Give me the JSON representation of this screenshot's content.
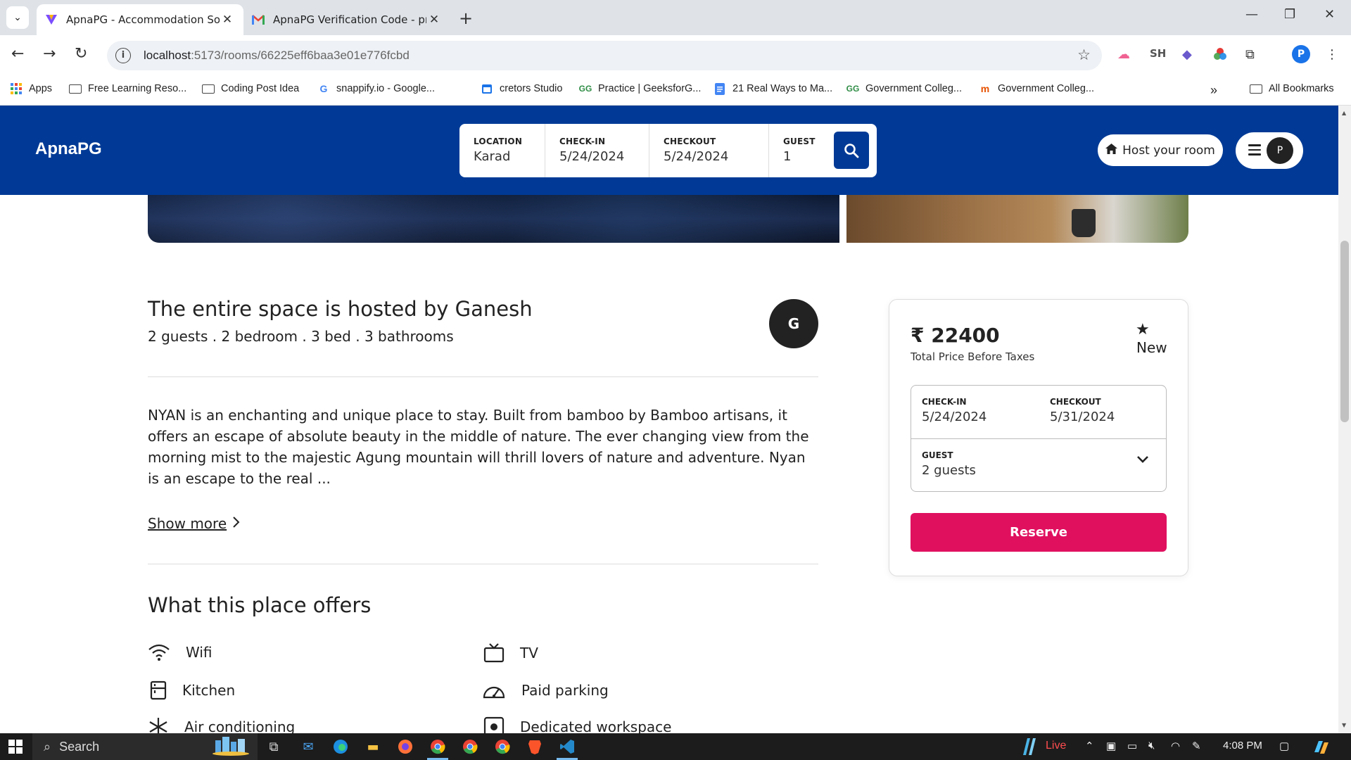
{
  "browser": {
    "tabs": [
      {
        "title": "ApnaPG - Accommodation Solu",
        "active": true
      },
      {
        "title": "ApnaPG Verification Code - pra",
        "active": false
      }
    ],
    "url_host": "localhost",
    "url_path": ":5173/rooms/66225eff6baa3e01e776fcbd",
    "profile_initial": "P",
    "ext_sh": "SH",
    "bookmarks": [
      "Apps",
      "Free Learning Reso...",
      "Coding Post Idea",
      "snappify.io - Google...",
      "cretors Studio",
      "Practice | GeeksforG...",
      "21 Real Ways to Ma...",
      "Government Colleg...",
      "Government Colleg...",
      "All Bookmarks"
    ]
  },
  "site": {
    "logo": "ApnaPG",
    "search": {
      "location_label": "LOCATION",
      "location_value": "Karad",
      "checkin_label": "CHECK-IN",
      "checkin_value": "5/24/2024",
      "checkout_label": "CHECKOUT",
      "checkout_value": "5/24/2024",
      "guest_label": "GUEST",
      "guest_value": "1"
    },
    "host_button": "Host your room",
    "avatar_initial": "P"
  },
  "listing": {
    "title": "The entire space is hosted by Ganesh",
    "subtitle": "2 guests . 2 bedroom . 3 bed . 3 bathrooms",
    "host_initial": "G",
    "description": "NYAN is an enchanting and unique place to stay. Built from bamboo by Bamboo artisans, it offers an escape of absolute beauty in the middle of nature. The ever changing view from the morning mist to the majestic Agung mountain will thrill lovers of nature and adventure. Nyan is an escape to the real ...",
    "show_more": "Show more",
    "offers_title": "What this place offers",
    "amenities": [
      "Wifi",
      "TV",
      "Kitchen",
      "Paid parking",
      "Air conditioning",
      "Dedicated workspace"
    ]
  },
  "booking": {
    "currency": "₹",
    "price": "22400",
    "price_note": "Total Price Before Taxes",
    "badge": "New",
    "checkin_label": "CHECK-IN",
    "checkin_value": "5/24/2024",
    "checkout_label": "CHECKOUT",
    "checkout_value": "5/31/2024",
    "guest_label": "GUEST",
    "guest_value": "2 guests",
    "reserve": "Reserve"
  },
  "taskbar": {
    "search_placeholder": "Search",
    "live": "Live",
    "time": "4:08 PM"
  },
  "colors": {
    "brand_blue": "#003a96",
    "reserve_pink": "#e0105f"
  }
}
